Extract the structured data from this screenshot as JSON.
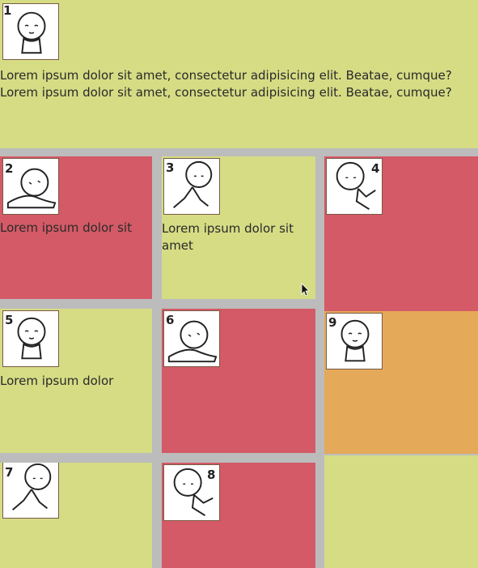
{
  "items": [
    {
      "number": "1",
      "lines": [
        "Lorem ipsum dolor sit amet, consectetur adipisicing elit. Beatae, cumque?",
        "Lorem ipsum dolor sit amet, consectetur adipisicing elit. Beatae, cumque?"
      ]
    },
    {
      "number": "2",
      "lines": [
        "Lorem ipsum dolor sit"
      ]
    },
    {
      "number": "3",
      "lines": [
        "Lorem ipsum dolor sit",
        "amet"
      ]
    },
    {
      "number": "4",
      "lines": []
    },
    {
      "number": "5",
      "lines": [
        "Lorem ipsum dolor"
      ]
    },
    {
      "number": "6",
      "lines": []
    },
    {
      "number": "7",
      "lines": []
    },
    {
      "number": "8",
      "lines": []
    },
    {
      "number": "9",
      "lines": []
    }
  ],
  "colors": {
    "yellow": "#d5dc84",
    "red": "#d35a66",
    "orange": "#e5a95a",
    "gap": "#bcbcbc"
  },
  "icons": {
    "avatar": "bald-character-icon"
  }
}
